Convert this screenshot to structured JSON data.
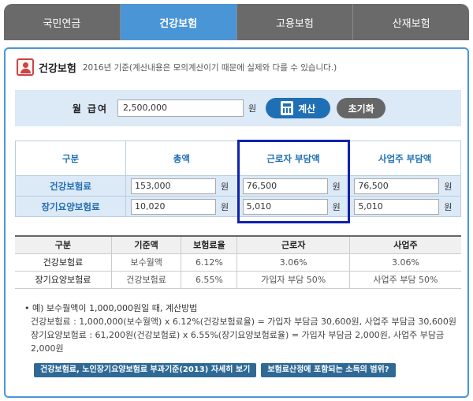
{
  "tabs": [
    "국민연금",
    "건강보험",
    "고용보험",
    "산재보험"
  ],
  "active_tab_index": 1,
  "heading": {
    "title": "건강보험",
    "note": "2016년 기준(계산내용은 모의계산이기 때문에 실제와 다를 수 있습니다.)"
  },
  "salary": {
    "label": "월 급여",
    "value": "2,500,000",
    "unit": "원",
    "calc_button": "계산",
    "reset_button": "초기화"
  },
  "result": {
    "headers": [
      "구분",
      "총액",
      "근로자 부담액",
      "사업주 부담액"
    ],
    "unit": "원",
    "rows": [
      {
        "label": "건강보험료",
        "values": [
          "153,000",
          "76,500",
          "76,500"
        ]
      },
      {
        "label": "장기요양보험료",
        "values": [
          "10,020",
          "5,010",
          "5,010"
        ]
      }
    ]
  },
  "rates": {
    "headers": [
      "구분",
      "기준액",
      "보험료율",
      "근로자",
      "사업주"
    ],
    "rows": [
      [
        "건강보험료",
        "보수월액",
        "6.12%",
        "3.06%",
        "3.06%"
      ],
      [
        "장기요양보험료",
        "건강보험료",
        "6.55%",
        "가입자 부담 50%",
        "사업주 부담 50%"
      ]
    ]
  },
  "example": {
    "line1": "• 예) 보수월액이 1,000,000원일 때, 계산방법",
    "line2": "건강보험료 : 1,000,000(보수월액) x 6.12%(건강보험료율) = 가입자 부담금 30,600원, 사업주 부담금 30,600원",
    "line3": "장기요양보험료 : 61,200원(건강보험료) x 6.55%(장기요양보험료율) = 가입자 부담금 2,000원, 사업주 부담금 2,000원"
  },
  "links": [
    "건강보험료, 노인장기요양보험료 부과기준(2013) 자세히 보기",
    "보험료산정에 포함되는 소득의 범위?"
  ],
  "colors": {
    "accent": "#4a95d6",
    "tab_inactive": "#6a6a6a",
    "highlight_border": "#1122aa"
  }
}
